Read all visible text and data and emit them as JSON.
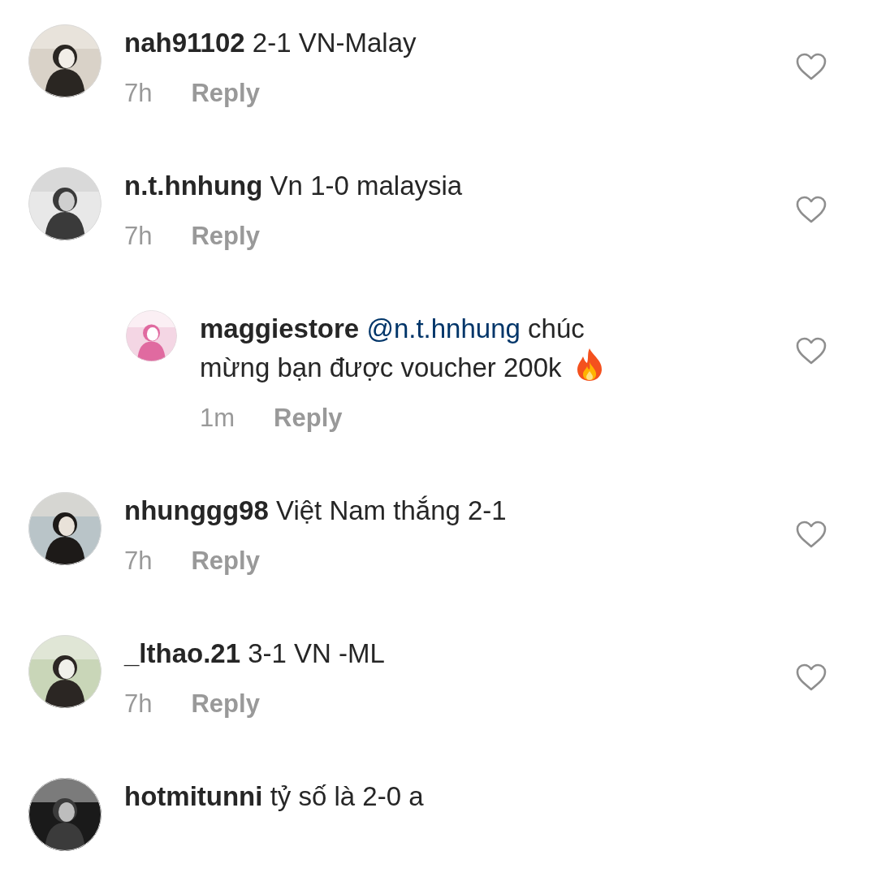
{
  "comments": [
    {
      "user": "nah91102",
      "text": "2-1 VN-Malay",
      "time": "7h",
      "reply_label": "Reply",
      "liked": false
    },
    {
      "user": "n.t.hnhung",
      "text": "Vn 1-0 malaysia",
      "time": "7h",
      "reply_label": "Reply",
      "liked": false,
      "children": [
        {
          "user": "maggiestore",
          "mention": "@n.t.hnhung",
          "text": "chúc mừng bạn được voucher 200k",
          "trailing_icon": true,
          "time": "1m",
          "reply_label": "Reply",
          "liked": false
        }
      ]
    },
    {
      "user": "nhunggg98",
      "text": "Việt Nam thắng 2-1",
      "time": "7h",
      "reply_label": "Reply",
      "liked": false
    },
    {
      "user": "_lthao.21",
      "text": "3-1 VN -ML",
      "time": "7h",
      "reply_label": "Reply",
      "liked": false
    },
    {
      "user": "hotmitunni",
      "text": "tỷ số là 2-0 a"
    }
  ]
}
